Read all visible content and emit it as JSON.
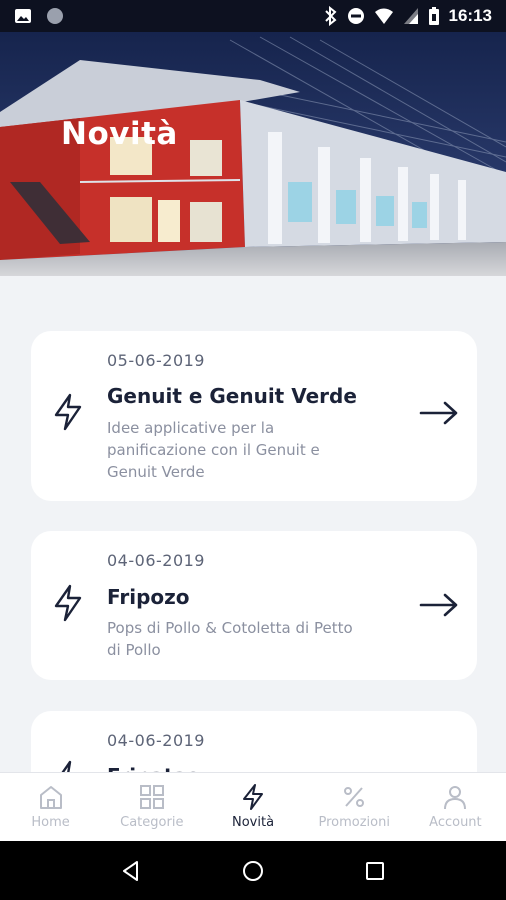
{
  "status_bar": {
    "time": "16:13",
    "icons": [
      "image-icon",
      "circle-icon",
      "bluetooth-icon",
      "do-not-disturb-icon",
      "wifi-icon",
      "signal-icon",
      "battery-icon"
    ]
  },
  "hero": {
    "title": "Novità"
  },
  "news": [
    {
      "date": "05-06-2019",
      "title": "Genuit e Genuit Verde",
      "description": "Idee applicative per la panificazione con il Genuit e Genuit Verde"
    },
    {
      "date": "04-06-2019",
      "title": "Fripozo",
      "description": "Pops di Pollo & Cotoletta di Petto di Pollo"
    },
    {
      "date": "04-06-2019",
      "title": "Fripatas",
      "description": ""
    }
  ],
  "bottom_nav": {
    "items": [
      {
        "label": "Home",
        "icon": "home-icon",
        "active": false
      },
      {
        "label": "Categorie",
        "icon": "grid-icon",
        "active": false
      },
      {
        "label": "Novità",
        "icon": "bolt-icon",
        "active": true
      },
      {
        "label": "Promozioni",
        "icon": "percent-icon",
        "active": false
      },
      {
        "label": "Account",
        "icon": "user-icon",
        "active": false
      }
    ]
  },
  "colors": {
    "accent": "#1b2238",
    "inactive": "#b9bdc7",
    "background": "#f1f3f6",
    "card": "#ffffff"
  }
}
